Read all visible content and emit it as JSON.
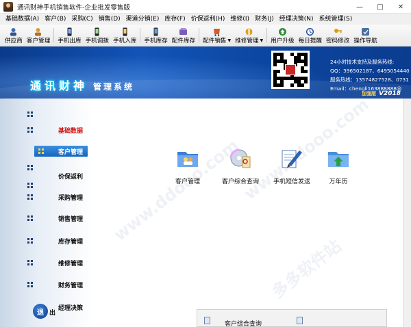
{
  "window": {
    "title": "通讯财神手机销售软件-企业批发零售版"
  },
  "menu": {
    "items": [
      "基础数据(A)",
      "客户(B)",
      "采购(C)",
      "销售(D)",
      "渠道分销(E)",
      "库存(F)",
      "价保返利(H)",
      "维修(I)",
      "财务(J)",
      "经理决策(N)",
      "系统管理(S)"
    ]
  },
  "toolbar": {
    "buttons": [
      {
        "label": "供应商",
        "icon": "supplier-icon"
      },
      {
        "label": "客户管理",
        "icon": "customer-icon"
      },
      {
        "label": "手机出库",
        "icon": "phone-out-icon"
      },
      {
        "label": "手机调拨",
        "icon": "phone-transfer-icon"
      },
      {
        "label": "手机入库",
        "icon": "phone-in-icon"
      },
      {
        "label": "手机库存",
        "icon": "phone-stock-icon"
      },
      {
        "label": "配件库存",
        "icon": "parts-stock-icon"
      },
      {
        "label": "配件销售",
        "icon": "parts-sale-icon"
      },
      {
        "label": "维修管理",
        "icon": "repair-icon"
      },
      {
        "label": "用户升级",
        "icon": "upgrade-icon"
      },
      {
        "label": "每日提醒",
        "icon": "reminder-icon"
      },
      {
        "label": "密码修改",
        "icon": "key-icon"
      },
      {
        "label": "操作导航",
        "icon": "navigation-icon"
      }
    ]
  },
  "banner": {
    "brand_main": "通讯财神",
    "brand_sub": "管理系统",
    "support": {
      "heading": "24小时技术支持及服务热线:",
      "qq": "QQ：396502187、6495054440",
      "hotline": "服务热线：13574827528、0731",
      "email": "Email：chengli163888888@"
    },
    "edition_badge": "加强版",
    "version": "V2018"
  },
  "nav": {
    "items": [
      {
        "label": ""
      },
      {
        "label": "基础数据"
      },
      {
        "label": "客户管理"
      },
      {
        "label": ""
      },
      {
        "label": "价保返利"
      },
      {
        "label": "采购管理"
      },
      {
        "label": "销售管理"
      },
      {
        "label": "库存管理"
      },
      {
        "label": "维修管理"
      },
      {
        "label": "财务管理"
      }
    ],
    "exit_label": "退",
    "exit_tail": "出",
    "bottom_label": "经理决策"
  },
  "functions": [
    {
      "label": "客户管理",
      "icon": "folder-people-icon"
    },
    {
      "label": "客户综合查询",
      "icon": "cd-search-icon"
    },
    {
      "label": "手机短信发送",
      "icon": "sms-pen-icon"
    },
    {
      "label": "万年历",
      "icon": "calendar-arrow-icon"
    }
  ],
  "bottom_panel": {
    "label": "客户综合查询"
  },
  "watermark": "www.ddooo.com",
  "watermark2": "多多软件站"
}
